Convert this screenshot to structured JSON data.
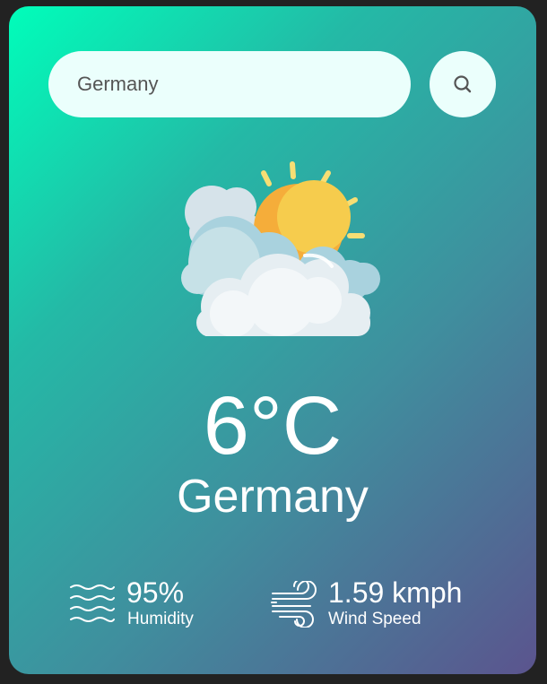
{
  "search": {
    "value": "Germany",
    "icon": "search-icon"
  },
  "weather": {
    "icon": "sun-behind-clouds-icon",
    "temperature": "6°C",
    "city": "Germany"
  },
  "details": {
    "humidity": {
      "value": "95%",
      "label": "Humidity",
      "icon": "humidity-waves-icon"
    },
    "wind": {
      "value": "1.59 kmph",
      "label": "Wind Speed",
      "icon": "wind-icon"
    }
  },
  "colors": {
    "gradient_start": "#00feba",
    "gradient_end": "#5b548e",
    "input_background": "#ebfffc",
    "text": "#ffffff"
  }
}
